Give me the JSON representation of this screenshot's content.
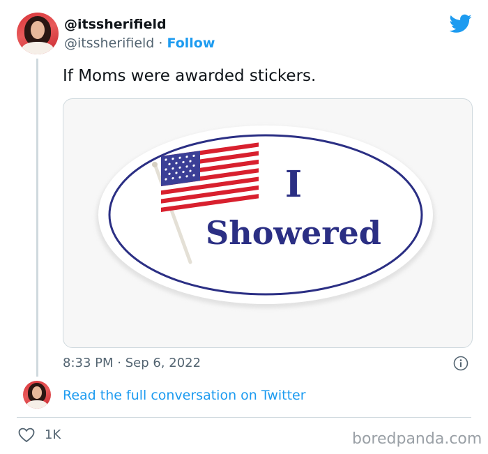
{
  "tweet": {
    "display_name": "@itssherifield",
    "handle": "@itssherifield",
    "separator": "·",
    "follow_label": "Follow",
    "text": "If Moms were awarded stickers.",
    "timestamp": "8:33 PM · Sep 6, 2022",
    "read_link": "Read the full conversation on Twitter",
    "likes": "1K"
  },
  "sticker": {
    "line1": "I",
    "line2": "Showered"
  },
  "watermark": "boredpanda.com",
  "colors": {
    "accent": "#1d9bf0",
    "sticker_blue": "#2b2f84",
    "flag_red": "#d8202e"
  },
  "icons": {
    "logo": "twitter-bird-icon",
    "info": "info-icon",
    "like": "heart-icon"
  }
}
